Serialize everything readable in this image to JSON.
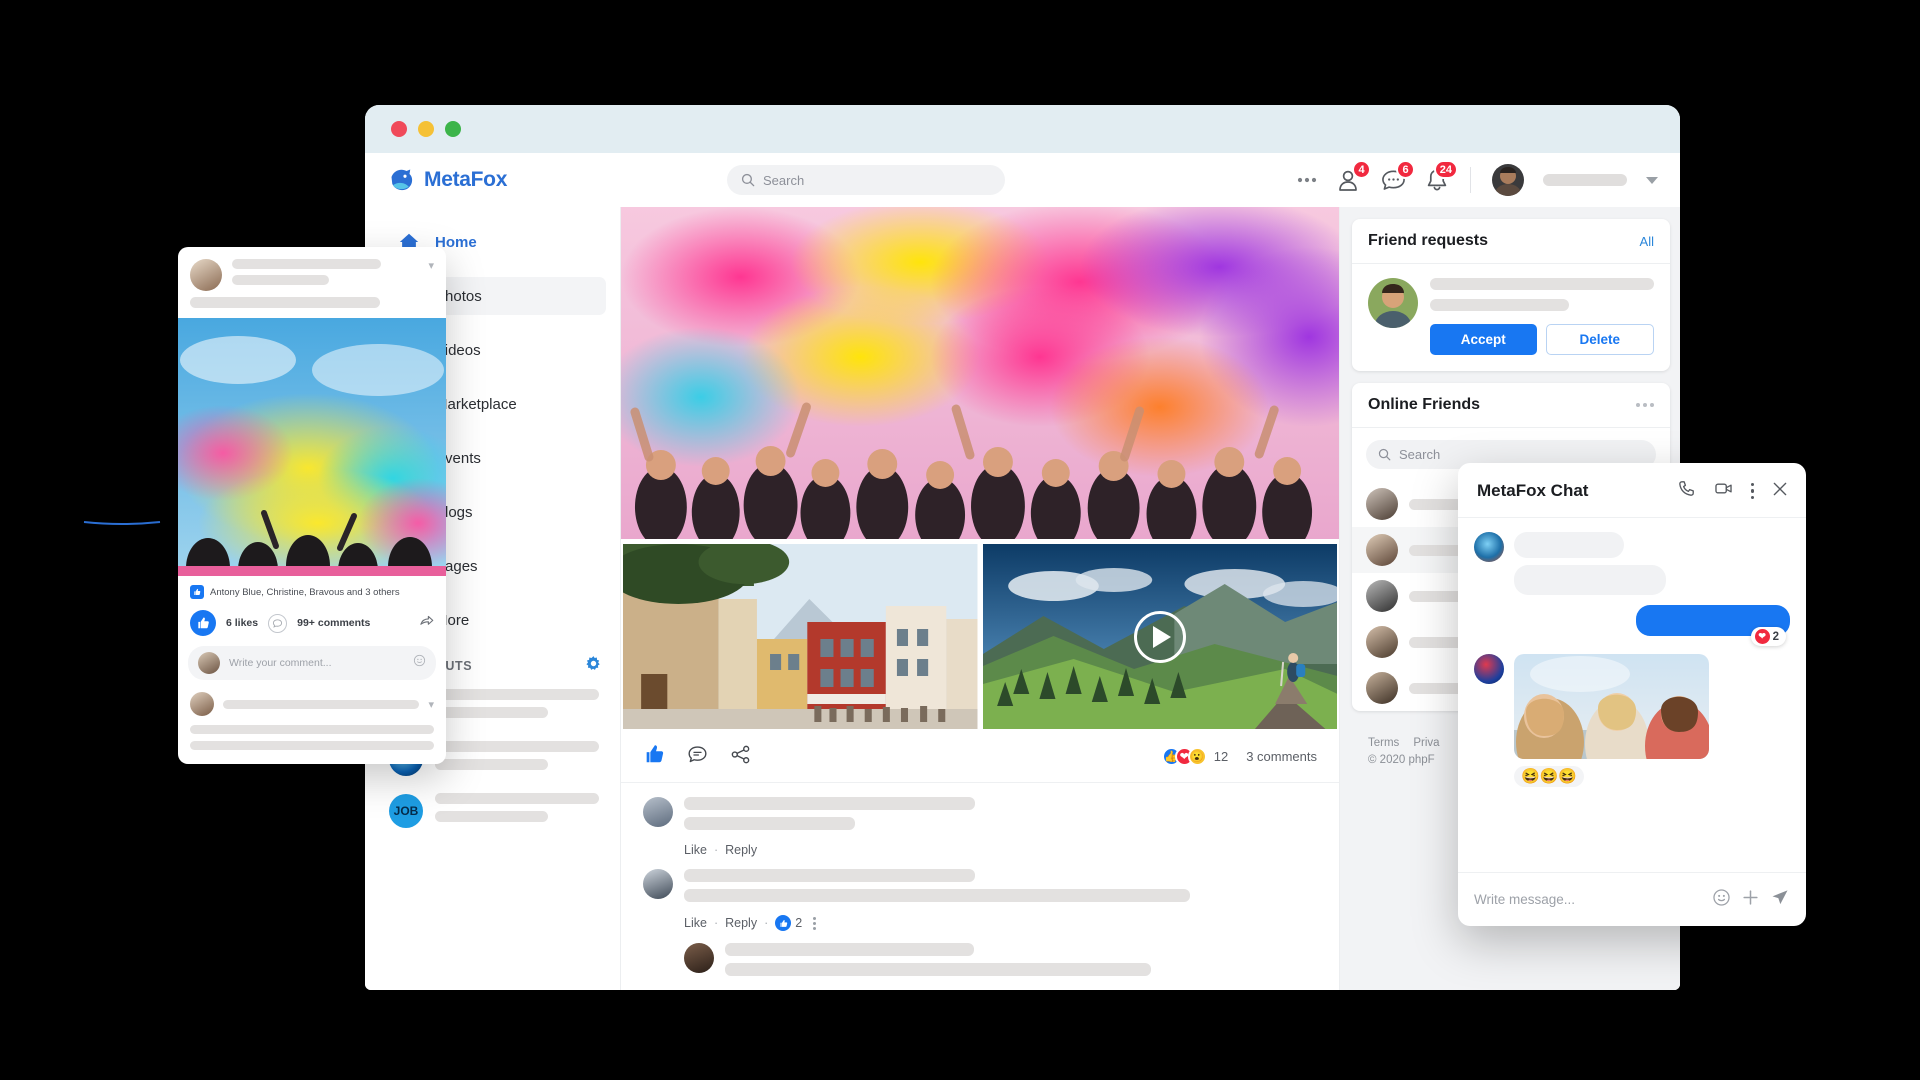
{
  "brand": {
    "name": "MetaFox",
    "accent": "#2b6fd4"
  },
  "window_controls": {
    "close": "close-dot",
    "minimize": "minimize-dot",
    "zoom": "zoom-dot"
  },
  "topnav": {
    "search_placeholder": "Search",
    "more_icon": "more-horizontal-icon",
    "friend_requests_badge": "4",
    "messages_badge": "6",
    "notifications_badge": "24",
    "account_caret": "chevron-down-icon"
  },
  "sidebar": {
    "items": [
      {
        "label": "Home",
        "icon": "home-icon",
        "active": true
      },
      {
        "label": "Photos",
        "icon": "photos-icon",
        "active": false
      },
      {
        "label": "Videos",
        "icon": "videos-icon",
        "active": false
      },
      {
        "label": "Marketplace",
        "icon": "marketplace-icon",
        "active": false
      },
      {
        "label": "Events",
        "icon": "events-icon",
        "active": false
      },
      {
        "label": "Blogs",
        "icon": "blogs-icon",
        "active": false
      },
      {
        "label": "Pages",
        "icon": "pages-icon",
        "active": false
      },
      {
        "label": "More",
        "icon": "more-icon",
        "active": false
      }
    ],
    "shortcuts_title": "SHORTCUTS",
    "shortcuts_settings_icon": "gear-icon"
  },
  "feed": {
    "post": {
      "hero_alt": "holi-festival-color-powder-crowd",
      "photo_alt": "italian-town-street",
      "video_alt": "mountain-hiker-video",
      "video_play_icon": "play-icon",
      "like_icon": "thumbs-up-icon",
      "comment_icon": "comment-icon",
      "share_icon": "share-icon",
      "reaction_count": "12",
      "reactions": [
        "like",
        "love",
        "wow"
      ],
      "comments_label": "3 comments"
    },
    "comments": [
      {
        "like_label": "Like",
        "reply_label": "Reply",
        "sep": "·",
        "like_count": null
      },
      {
        "like_label": "Like",
        "reply_label": "Reply",
        "sep": "·",
        "like_count": "2"
      }
    ]
  },
  "right_rail": {
    "friend_requests": {
      "title": "Friend requests",
      "all_link": "All",
      "accept_label": "Accept",
      "delete_label": "Delete"
    },
    "online_friends": {
      "title": "Online Friends",
      "menu_icon": "more-horizontal-icon",
      "search_placeholder": "Search"
    },
    "footer": {
      "terms": "Terms",
      "privacy": "Priva",
      "copyright": "© 2020 phpF"
    }
  },
  "float_post": {
    "chevron_icon": "chevron-down-icon",
    "likes_names": "Antony Blue, Christine, Bravous and 3 others",
    "likes_label": "6 likes",
    "comments_label": "99+ comments",
    "comment_placeholder": "Write your comment...",
    "share_icon": "share-icon",
    "emoji_icon": "emoji-icon",
    "image_alt": "color-powder-festival-sky"
  },
  "chat": {
    "title": "MetaFox Chat",
    "call_icon": "phone-icon",
    "video_icon": "video-camera-icon",
    "menu_icon": "more-vertical-icon",
    "close_icon": "close-icon",
    "reaction_count": "2",
    "reaction_icon": "heart-icon",
    "photo_alt": "three-friends-outdoors",
    "emoji_reactions": "😆😆😆",
    "input_placeholder": "Write message...",
    "emoji_icon": "emoji-icon",
    "attach_icon": "plus-icon",
    "send_icon": "send-icon"
  }
}
